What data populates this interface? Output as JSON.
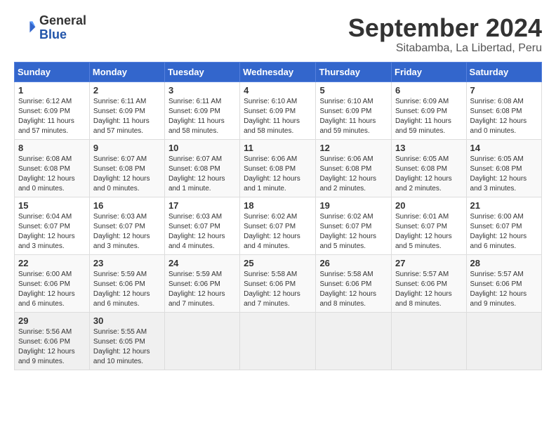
{
  "header": {
    "logo_general": "General",
    "logo_blue": "Blue",
    "month_title": "September 2024",
    "location": "Sitabamba, La Libertad, Peru"
  },
  "days_of_week": [
    "Sunday",
    "Monday",
    "Tuesday",
    "Wednesday",
    "Thursday",
    "Friday",
    "Saturday"
  ],
  "weeks": [
    [
      {
        "day": "1",
        "info": "Sunrise: 6:12 AM\nSunset: 6:09 PM\nDaylight: 11 hours\nand 57 minutes."
      },
      {
        "day": "2",
        "info": "Sunrise: 6:11 AM\nSunset: 6:09 PM\nDaylight: 11 hours\nand 57 minutes."
      },
      {
        "day": "3",
        "info": "Sunrise: 6:11 AM\nSunset: 6:09 PM\nDaylight: 11 hours\nand 58 minutes."
      },
      {
        "day": "4",
        "info": "Sunrise: 6:10 AM\nSunset: 6:09 PM\nDaylight: 11 hours\nand 58 minutes."
      },
      {
        "day": "5",
        "info": "Sunrise: 6:10 AM\nSunset: 6:09 PM\nDaylight: 11 hours\nand 59 minutes."
      },
      {
        "day": "6",
        "info": "Sunrise: 6:09 AM\nSunset: 6:09 PM\nDaylight: 11 hours\nand 59 minutes."
      },
      {
        "day": "7",
        "info": "Sunrise: 6:08 AM\nSunset: 6:08 PM\nDaylight: 12 hours\nand 0 minutes."
      }
    ],
    [
      {
        "day": "8",
        "info": "Sunrise: 6:08 AM\nSunset: 6:08 PM\nDaylight: 12 hours\nand 0 minutes."
      },
      {
        "day": "9",
        "info": "Sunrise: 6:07 AM\nSunset: 6:08 PM\nDaylight: 12 hours\nand 0 minutes."
      },
      {
        "day": "10",
        "info": "Sunrise: 6:07 AM\nSunset: 6:08 PM\nDaylight: 12 hours\nand 1 minute."
      },
      {
        "day": "11",
        "info": "Sunrise: 6:06 AM\nSunset: 6:08 PM\nDaylight: 12 hours\nand 1 minute."
      },
      {
        "day": "12",
        "info": "Sunrise: 6:06 AM\nSunset: 6:08 PM\nDaylight: 12 hours\nand 2 minutes."
      },
      {
        "day": "13",
        "info": "Sunrise: 6:05 AM\nSunset: 6:08 PM\nDaylight: 12 hours\nand 2 minutes."
      },
      {
        "day": "14",
        "info": "Sunrise: 6:05 AM\nSunset: 6:08 PM\nDaylight: 12 hours\nand 3 minutes."
      }
    ],
    [
      {
        "day": "15",
        "info": "Sunrise: 6:04 AM\nSunset: 6:07 PM\nDaylight: 12 hours\nand 3 minutes."
      },
      {
        "day": "16",
        "info": "Sunrise: 6:03 AM\nSunset: 6:07 PM\nDaylight: 12 hours\nand 3 minutes."
      },
      {
        "day": "17",
        "info": "Sunrise: 6:03 AM\nSunset: 6:07 PM\nDaylight: 12 hours\nand 4 minutes."
      },
      {
        "day": "18",
        "info": "Sunrise: 6:02 AM\nSunset: 6:07 PM\nDaylight: 12 hours\nand 4 minutes."
      },
      {
        "day": "19",
        "info": "Sunrise: 6:02 AM\nSunset: 6:07 PM\nDaylight: 12 hours\nand 5 minutes."
      },
      {
        "day": "20",
        "info": "Sunrise: 6:01 AM\nSunset: 6:07 PM\nDaylight: 12 hours\nand 5 minutes."
      },
      {
        "day": "21",
        "info": "Sunrise: 6:00 AM\nSunset: 6:07 PM\nDaylight: 12 hours\nand 6 minutes."
      }
    ],
    [
      {
        "day": "22",
        "info": "Sunrise: 6:00 AM\nSunset: 6:06 PM\nDaylight: 12 hours\nand 6 minutes."
      },
      {
        "day": "23",
        "info": "Sunrise: 5:59 AM\nSunset: 6:06 PM\nDaylight: 12 hours\nand 6 minutes."
      },
      {
        "day": "24",
        "info": "Sunrise: 5:59 AM\nSunset: 6:06 PM\nDaylight: 12 hours\nand 7 minutes."
      },
      {
        "day": "25",
        "info": "Sunrise: 5:58 AM\nSunset: 6:06 PM\nDaylight: 12 hours\nand 7 minutes."
      },
      {
        "day": "26",
        "info": "Sunrise: 5:58 AM\nSunset: 6:06 PM\nDaylight: 12 hours\nand 8 minutes."
      },
      {
        "day": "27",
        "info": "Sunrise: 5:57 AM\nSunset: 6:06 PM\nDaylight: 12 hours\nand 8 minutes."
      },
      {
        "day": "28",
        "info": "Sunrise: 5:57 AM\nSunset: 6:06 PM\nDaylight: 12 hours\nand 9 minutes."
      }
    ],
    [
      {
        "day": "29",
        "info": "Sunrise: 5:56 AM\nSunset: 6:06 PM\nDaylight: 12 hours\nand 9 minutes."
      },
      {
        "day": "30",
        "info": "Sunrise: 5:55 AM\nSunset: 6:05 PM\nDaylight: 12 hours\nand 10 minutes."
      },
      {
        "day": "",
        "info": ""
      },
      {
        "day": "",
        "info": ""
      },
      {
        "day": "",
        "info": ""
      },
      {
        "day": "",
        "info": ""
      },
      {
        "day": "",
        "info": ""
      }
    ]
  ]
}
